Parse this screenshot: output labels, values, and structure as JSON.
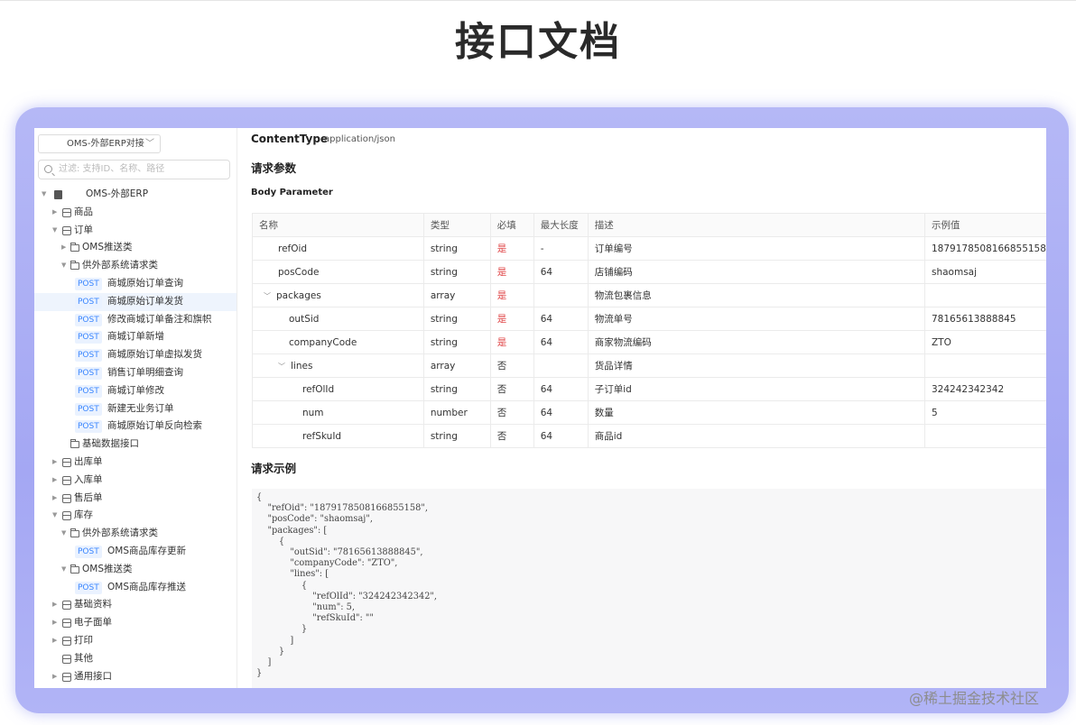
{
  "page": {
    "title": "接口文档",
    "watermark": "@稀土掘金技术社区"
  },
  "sidebar": {
    "project_select": "OMS-外部ERP对接",
    "search_placeholder": "过滤: 支持ID、名称、路径",
    "tree": [
      {
        "level": 0,
        "type": "root",
        "expanded": true,
        "label": "OMS-外部ERP"
      },
      {
        "level": 1,
        "type": "box",
        "expanded": false,
        "label": "商品"
      },
      {
        "level": 1,
        "type": "box",
        "expanded": true,
        "label": "订单"
      },
      {
        "level": 2,
        "type": "folder",
        "expanded": false,
        "label": "OMS推送类"
      },
      {
        "level": 2,
        "type": "folder",
        "expanded": true,
        "label": "供外部系统请求类"
      },
      {
        "level": 3,
        "type": "post",
        "method": "POST",
        "label": "商城原始订单查询"
      },
      {
        "level": 3,
        "type": "post",
        "method": "POST",
        "label": "商城原始订单发货",
        "selected": true
      },
      {
        "level": 3,
        "type": "post",
        "method": "POST",
        "label": "修改商城订单备注和旗帜"
      },
      {
        "level": 3,
        "type": "post",
        "method": "POST",
        "label": "商城订单新增"
      },
      {
        "level": 3,
        "type": "post",
        "method": "POST",
        "label": "商城原始订单虚拟发货"
      },
      {
        "level": 3,
        "type": "post",
        "method": "POST",
        "label": "销售订单明细查询"
      },
      {
        "level": 3,
        "type": "post",
        "method": "POST",
        "label": "商城订单修改"
      },
      {
        "level": 3,
        "type": "post",
        "method": "POST",
        "label": "新建无业务订单"
      },
      {
        "level": 3,
        "type": "post",
        "method": "POST",
        "label": "商城原始订单反向检索"
      },
      {
        "level": 2,
        "type": "folder",
        "expanded": null,
        "label": "基础数据接口"
      },
      {
        "level": 1,
        "type": "box",
        "expanded": false,
        "label": "出库单"
      },
      {
        "level": 1,
        "type": "box",
        "expanded": false,
        "label": "入库单"
      },
      {
        "level": 1,
        "type": "box",
        "expanded": false,
        "label": "售后单"
      },
      {
        "level": 1,
        "type": "box",
        "expanded": true,
        "label": "库存"
      },
      {
        "level": 2,
        "type": "folder",
        "expanded": true,
        "label": "供外部系统请求类"
      },
      {
        "level": 3,
        "type": "post",
        "method": "POST",
        "label": "OMS商品库存更新"
      },
      {
        "level": 2,
        "type": "folder",
        "expanded": true,
        "label": "OMS推送类"
      },
      {
        "level": 3,
        "type": "post",
        "method": "POST",
        "label": "OMS商品库存推送"
      },
      {
        "level": 1,
        "type": "box",
        "expanded": false,
        "label": "基础资料"
      },
      {
        "level": 1,
        "type": "box",
        "expanded": false,
        "label": "电子面单"
      },
      {
        "level": 1,
        "type": "box",
        "expanded": false,
        "label": "打印"
      },
      {
        "level": 1,
        "type": "box",
        "expanded": null,
        "label": "其他"
      },
      {
        "level": 1,
        "type": "box",
        "expanded": false,
        "label": "通用接口"
      }
    ]
  },
  "content": {
    "content_type_label": "ContentType",
    "content_type_value": "application/json",
    "request_params_title": "请求参数",
    "body_parameter_label": "Body Parameter",
    "table": {
      "headers": [
        "名称",
        "类型",
        "必填",
        "最大长度",
        "描述",
        "示例值"
      ],
      "rows": [
        {
          "indent": 1,
          "expander": "",
          "name": "refOid",
          "type": "string",
          "required": "是",
          "required_flag": true,
          "maxlen": "-",
          "desc": "订单编号",
          "example": "1879178508166855158"
        },
        {
          "indent": 1,
          "expander": "",
          "name": "posCode",
          "type": "string",
          "required": "是",
          "required_flag": true,
          "maxlen": "64",
          "desc": "店铺编码",
          "example": "shaomsaj"
        },
        {
          "indent": 0,
          "expander": "﹀",
          "name": "packages",
          "type": "array",
          "required": "是",
          "required_flag": true,
          "maxlen": "",
          "desc": "物流包裹信息",
          "example": ""
        },
        {
          "indent": 2,
          "expander": "",
          "name": "outSid",
          "type": "string",
          "required": "是",
          "required_flag": true,
          "maxlen": "64",
          "desc": "物流单号",
          "example": "78165613888845"
        },
        {
          "indent": 2,
          "expander": "",
          "name": "companyCode",
          "type": "string",
          "required": "是",
          "required_flag": true,
          "maxlen": "64",
          "desc": "商家物流编码",
          "example": "ZTO"
        },
        {
          "indent": 1,
          "expander": "﹀",
          "name": "lines",
          "type": "array",
          "required": "否",
          "required_flag": false,
          "maxlen": "",
          "desc": "货品详情",
          "example": ""
        },
        {
          "indent": 3,
          "expander": "",
          "name": "refOlId",
          "type": "string",
          "required": "否",
          "required_flag": false,
          "maxlen": "64",
          "desc": "子订单id",
          "example": "324242342342"
        },
        {
          "indent": 3,
          "expander": "",
          "name": "num",
          "type": "number",
          "required": "否",
          "required_flag": false,
          "maxlen": "64",
          "desc": "数量",
          "example": "5"
        },
        {
          "indent": 3,
          "expander": "",
          "name": "refSkuId",
          "type": "string",
          "required": "否",
          "required_flag": false,
          "maxlen": "64",
          "desc": "商品id",
          "example": ""
        }
      ]
    },
    "request_example_title": "请求示例",
    "request_example_code": "{\n    \"refOid\": \"1879178508166855158\",\n    \"posCode\": \"shaomsaj\",\n    \"packages\": [\n        {\n            \"outSid\": \"78165613888845\",\n            \"companyCode\": \"ZTO\",\n            \"lines\": [\n                {\n                    \"refOlId\": \"324242342342\",\n                    \"num\": 5,\n                    \"refSkuId\": \"\"\n                }\n            ]\n        }\n    ]\n}"
  }
}
